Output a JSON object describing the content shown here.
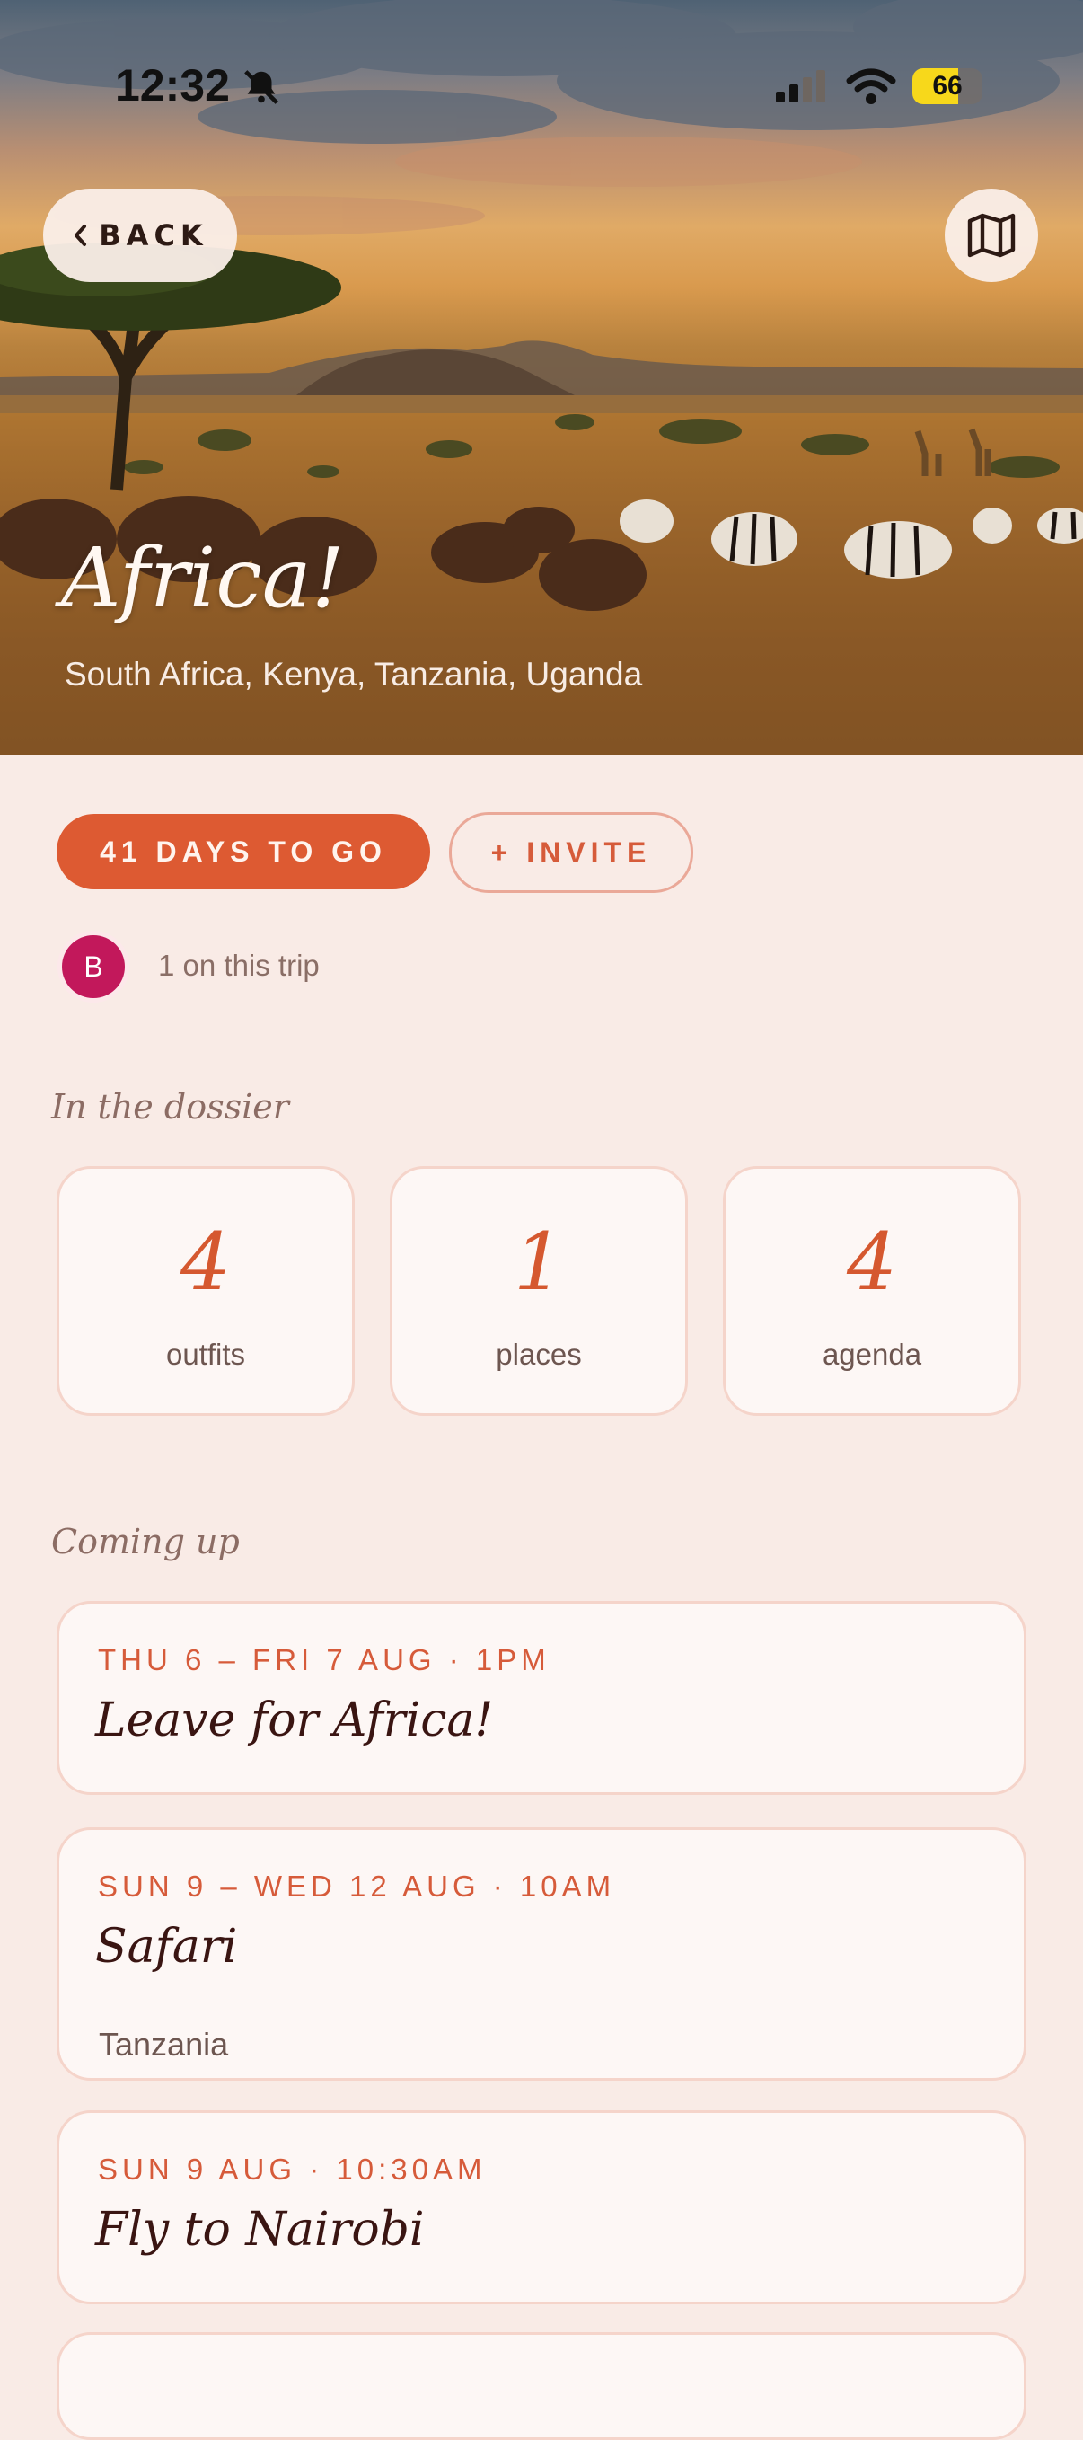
{
  "status_bar": {
    "time": "12:32",
    "battery": "66",
    "battery_level": 0.66
  },
  "header": {
    "back_label": "BACK",
    "map_icon": "map-icon",
    "title": "Africa!",
    "subtitle": "South Africa, Kenya, Tanzania, Uganda"
  },
  "actions": {
    "countdown_label": "41 DAYS TO GO",
    "invite_label": "+ INVITE"
  },
  "travelers": {
    "avatar_initial": "B",
    "count_label": "1 on this trip"
  },
  "dossier": {
    "heading": "In the dossier",
    "items": [
      {
        "value": "4",
        "label": "outfits"
      },
      {
        "value": "1",
        "label": "places"
      },
      {
        "value": "4",
        "label": "agenda"
      }
    ]
  },
  "upcoming": {
    "heading": "Coming up",
    "events": [
      {
        "date": "THU 6 – FRI 7 AUG · 1PM",
        "title": "Leave for Africa!"
      },
      {
        "date": "SUN 9 – WED 12 AUG · 10AM",
        "title": "Safari",
        "location": "Tanzania"
      },
      {
        "date": "SUN 9 AUG · 10:30AM",
        "title": "Fly to Nairobi"
      }
    ]
  },
  "colors": {
    "accent": "#dd5a32",
    "background": "#f9ebe6",
    "card": "#fdf7f5",
    "card_border": "#f5d4ca",
    "title_text": "#3a1512",
    "avatar": "#c2185b"
  }
}
